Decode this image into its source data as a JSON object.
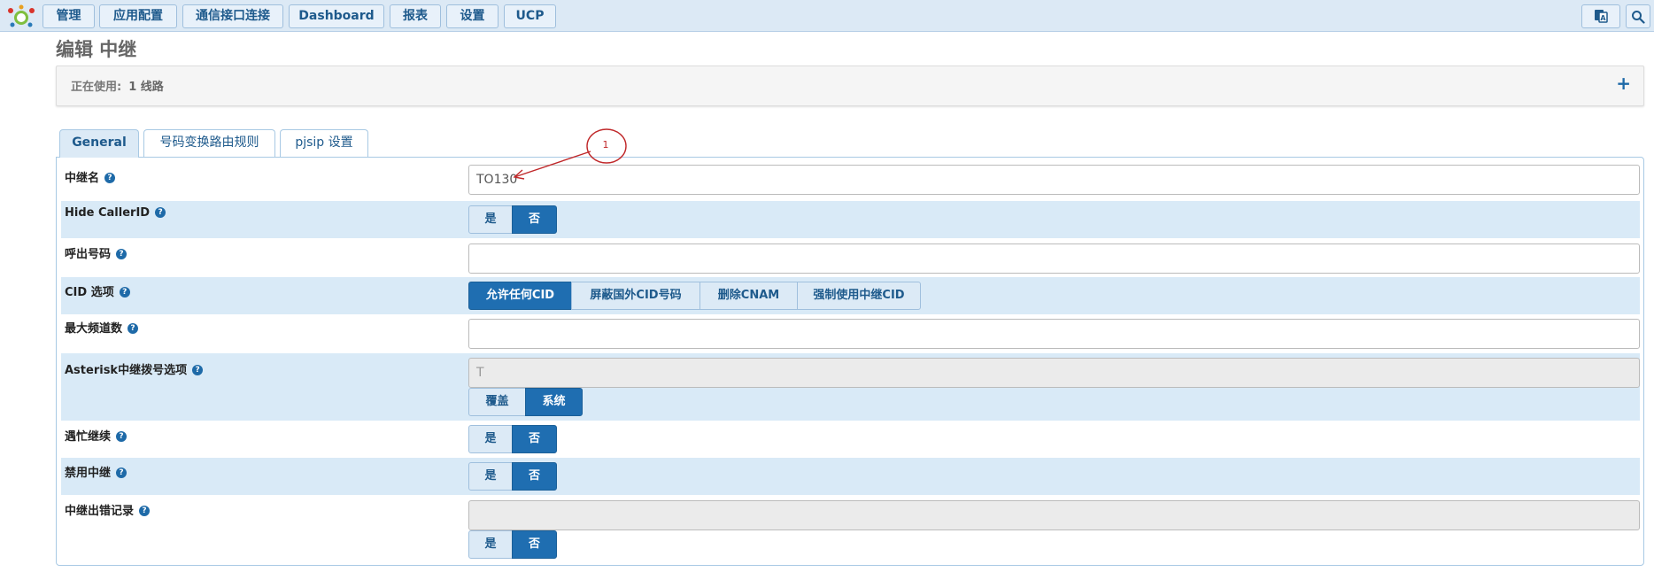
{
  "nav": {
    "items": [
      "管理",
      "应用配置",
      "通信接口连接",
      "Dashboard",
      "报表",
      "设置",
      "UCP"
    ],
    "logo_icon": "logo-icon",
    "translate_icon": "translate-icon",
    "search_icon": "search-icon"
  },
  "page": {
    "title": "编辑 中继"
  },
  "inuse": {
    "label": "正在使用:",
    "value": "1 线路",
    "add_icon": "+"
  },
  "tabs": [
    "General",
    "号码变换路由规则",
    "pjsip 设置"
  ],
  "form": {
    "trunk_name": {
      "label": "中继名",
      "value": "TO130"
    },
    "hide_callerid": {
      "label": "Hide CallerID",
      "options": [
        "是",
        "否"
      ],
      "selected": "否"
    },
    "outbound_cid": {
      "label": "呼出号码",
      "value": ""
    },
    "cid_options": {
      "label": "CID 选项",
      "options": [
        "允许任何CID",
        "屏蔽国外CID号码",
        "删除CNAM",
        "强制使用中继CID"
      ],
      "selected": "允许任何CID"
    },
    "max_channels": {
      "label": "最大频道数",
      "value": ""
    },
    "dial_options": {
      "label": "Asterisk中继拨号选项",
      "value": "T",
      "options": [
        "覆盖",
        "系统"
      ],
      "selected": "系统"
    },
    "continue_busy": {
      "label": "遇忙继续",
      "options": [
        "是",
        "否"
      ],
      "selected": "否"
    },
    "disable_trunk": {
      "label": "禁用中继",
      "options": [
        "是",
        "否"
      ],
      "selected": "否"
    },
    "monitor_failures": {
      "label": "中继出错记录",
      "value": "",
      "options": [
        "是",
        "否"
      ],
      "selected": "否"
    },
    "help_glyph": "?"
  },
  "annotation": {
    "label": "1"
  },
  "colors": {
    "accent": "#1f6eb1",
    "row_alt": "#d9eaf7",
    "nav_bg": "#dce9f5"
  }
}
